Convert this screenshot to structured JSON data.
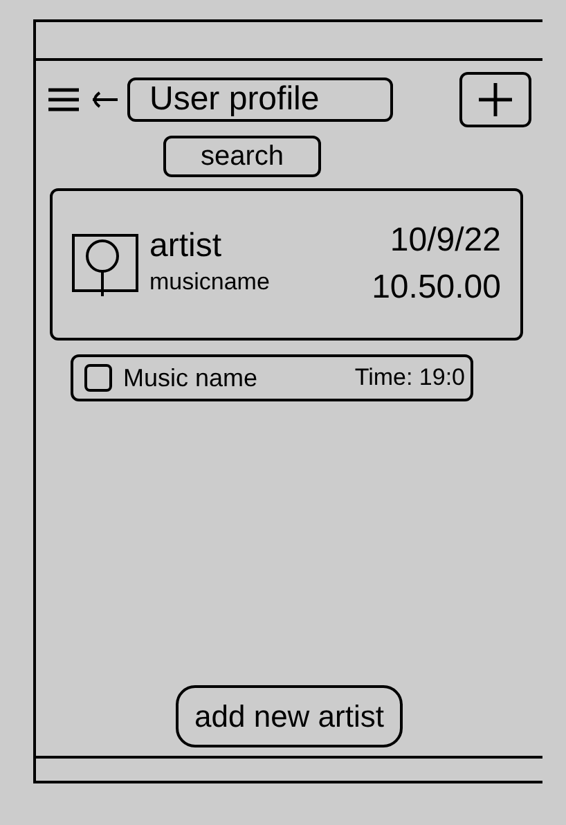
{
  "header": {
    "title": "User profile",
    "search_button": "search"
  },
  "entries": [
    {
      "kind": "featured",
      "title": "artist",
      "subtitle": "musicname",
      "date": "10/9/22",
      "time": "10.50.00"
    },
    {
      "kind": "compact",
      "title": "Music name",
      "time": "Time: 19:0"
    }
  ],
  "footer_button": "add new artist"
}
